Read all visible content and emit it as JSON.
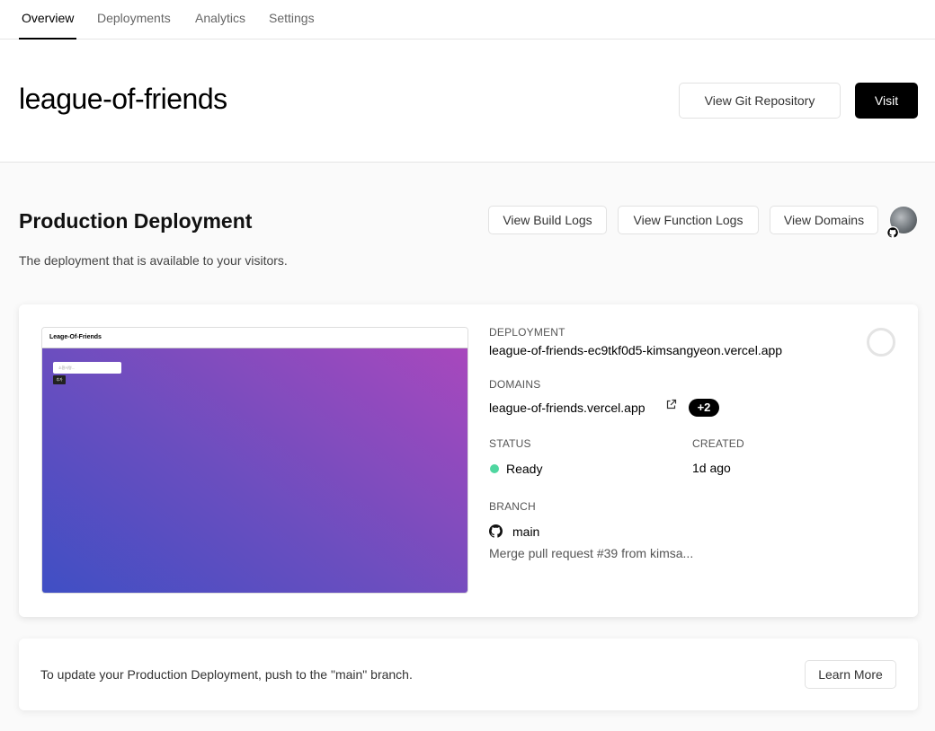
{
  "nav": {
    "tabs": [
      {
        "label": "Overview"
      },
      {
        "label": "Deployments"
      },
      {
        "label": "Analytics"
      },
      {
        "label": "Settings"
      }
    ]
  },
  "header": {
    "project_name": "league-of-friends",
    "git_button": "View Git Repository",
    "visit_button": "Visit"
  },
  "production": {
    "title": "Production Deployment",
    "subtitle": "The deployment that is available to your visitors.",
    "build_logs_button": "View Build Logs",
    "function_logs_button": "View Function Logs",
    "domains_button": "View Domains"
  },
  "deployment": {
    "preview": {
      "brand": "Leage-Of-Friends",
      "input_placeholder": "소환사명...",
      "button_label": "추가"
    },
    "deployment_label": "DEPLOYMENT",
    "deployment_url": "league-of-friends-ec9tkf0d5-kimsangyeon.vercel.app",
    "domains_label": "DOMAINS",
    "domain": "league-of-friends.vercel.app",
    "extra_domains": "+2",
    "status_label": "STATUS",
    "status": "Ready",
    "status_color": "#4fd6a0",
    "created_label": "CREATED",
    "created": "1d ago",
    "branch_label": "BRANCH",
    "branch": "main",
    "commit_message": "Merge pull request #39 from kimsa..."
  },
  "banner": {
    "text": "To update your Production Deployment, push to the \"main\" branch.",
    "learn_more_button": "Learn More"
  },
  "icons": [
    "external-link-icon",
    "github-icon",
    "loading-spinner-icon"
  ]
}
